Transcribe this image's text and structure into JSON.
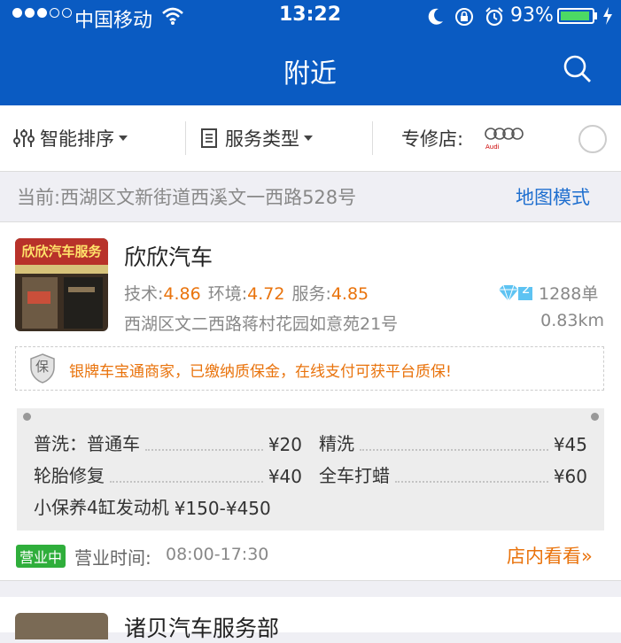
{
  "status_bar": {
    "carrier": "中国移动",
    "time": "13:22",
    "battery_percent_text": "93%",
    "battery_level": 0.93,
    "signal_bars_filled": 3,
    "signal_bars_total": 5
  },
  "nav": {
    "title": "附近",
    "search_icon": "search-icon"
  },
  "filters": {
    "sort_label": "智能排序",
    "service_type_label": "服务类型",
    "specialty_label": "专修店:",
    "brand_logo": "audi-logo",
    "brand_logo_text": "Audi"
  },
  "location": {
    "current_text": "当前:西湖区文新街道西溪文一西路528号",
    "map_mode": "地图模式"
  },
  "shop": {
    "image_sign_text": "欣欣汽车服务",
    "name": "欣欣汽车",
    "tech_label": "技术:",
    "tech_score": "4.86",
    "env_label": "环境:",
    "env_score": "4.72",
    "service_label": "服务:",
    "service_score": "4.85",
    "diamond_level": "2",
    "orders": "1288单",
    "address": "西湖区文二西路蒋村花园如意苑21号",
    "distance": "0.83km",
    "guarantee_badge": "保",
    "guarantee_text": "银牌车宝通商家，已缴纳质保金，在线支付可获平台质保!",
    "services": [
      {
        "name": "普洗：普通车",
        "price": "¥20"
      },
      {
        "name": "精洗",
        "price": "¥45"
      },
      {
        "name": "轮胎修复",
        "price": "¥40"
      },
      {
        "name": "全车打蜡",
        "price": "¥60"
      },
      {
        "name": "小保养4缸发动机",
        "price": "¥150-¥450"
      }
    ],
    "open_badge": "营业中",
    "hours_label": "营业时间:",
    "hours": "08:00-17:30",
    "view_store": "店内看看»"
  },
  "next_shop": {
    "name": "诸贝汽车服务部"
  },
  "colors": {
    "brand_blue": "#0a5bc2",
    "accent_orange": "#e9730c",
    "open_green": "#2fae3b",
    "link_blue": "#1f6fcf"
  }
}
